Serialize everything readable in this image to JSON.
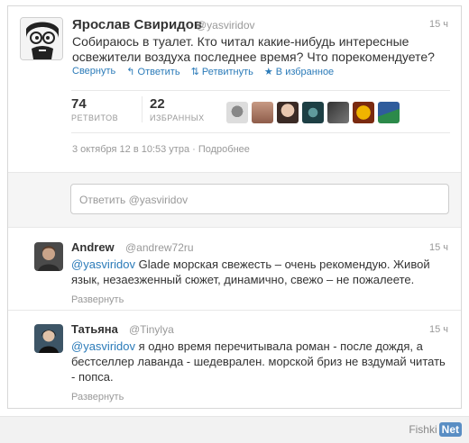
{
  "tweet": {
    "author_name": "Ярослав Свиридов",
    "handle": "@yasviridov",
    "time": "15 ч",
    "text": "Собираюсь в туалет. Кто читал какие-нибудь интересные освежители воздуха последнее время? Что порекомендуете?",
    "actions": {
      "collapse": "Свернуть",
      "reply": "Ответить",
      "retweet": "Ретвитнуть",
      "favorite": "В избранное"
    },
    "retweets": "74",
    "retweets_label": "РЕТВИТОВ",
    "favorites": "22",
    "favorites_label": "ИЗБРАННЫХ",
    "date": "3 октября 12 в 10:53 утра · Подробнее"
  },
  "reply_box": {
    "placeholder": "Ответить @yasviridov"
  },
  "replies": [
    {
      "name": "Andrew",
      "handle": "@andrew72ru",
      "time": "15 ч",
      "mention": "@yasviridov",
      "text": " Glade морская свежесть – очень рекомендую. Живой язык, незаезженный сюжет, динамично, свежо – не пожалеете.",
      "expand": "Развернуть"
    },
    {
      "name": "Татьяна",
      "handle": "@Tinylya",
      "time": "15 ч",
      "mention": "@yasviridov",
      "text": " я одно время перечитывала роман - после дождя, а бестселлер лаванда - шедеврален. морской бриз не вздумай читать - попса.",
      "expand": "Развернуть"
    }
  ],
  "watermark": {
    "brand": "Fishki",
    "suffix": "Net"
  },
  "colors": {
    "link": "#2b7bb9",
    "muted": "#999999"
  }
}
